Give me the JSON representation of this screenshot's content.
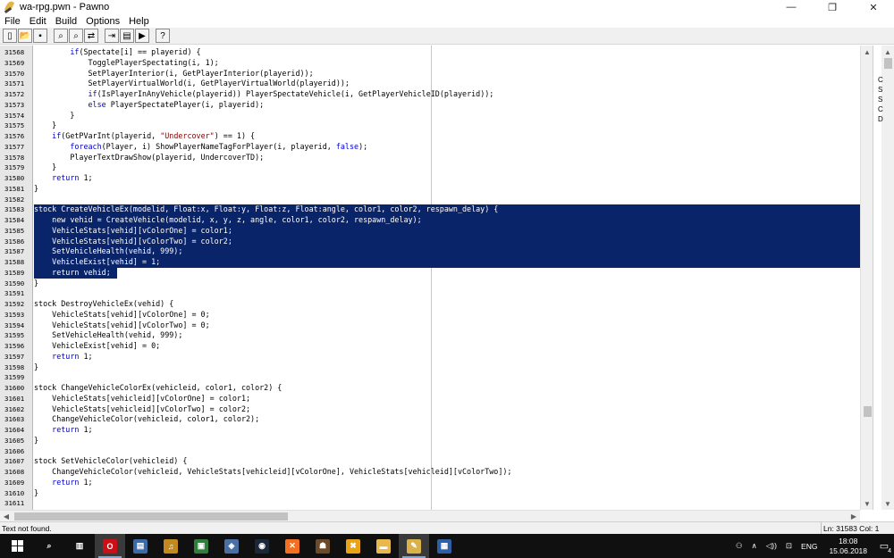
{
  "window": {
    "title": "wa-rpg.pwn - Pawno",
    "minimize": "—",
    "maximize": "❐",
    "close": "✕"
  },
  "menu": [
    "File",
    "Edit",
    "Build",
    "Options",
    "Help"
  ],
  "toolbar": [
    {
      "name": "new-icon",
      "glyph": "▯"
    },
    {
      "name": "open-icon",
      "glyph": "📂"
    },
    {
      "name": "save-icon",
      "glyph": "▪"
    },
    {
      "name": "find-icon",
      "glyph": "⌕"
    },
    {
      "name": "find-next-icon",
      "glyph": "⌕"
    },
    {
      "name": "replace-icon",
      "glyph": "⇄"
    },
    {
      "name": "goto-icon",
      "glyph": "⇥"
    },
    {
      "name": "compile-icon",
      "glyph": "▤"
    },
    {
      "name": "run-icon",
      "glyph": "▶"
    },
    {
      "name": "help-icon",
      "glyph": "?"
    }
  ],
  "editor": {
    "lines": [
      {
        "n": "31568",
        "t": "        if(Spectate[i] == playerid) {"
      },
      {
        "n": "31569",
        "t": "            TogglePlayerSpectating(i, 1);"
      },
      {
        "n": "31570",
        "t": "            SetPlayerInterior(i, GetPlayerInterior(playerid));"
      },
      {
        "n": "31571",
        "t": "            SetPlayerVirtualWorld(i, GetPlayerVirtualWorld(playerid));"
      },
      {
        "n": "31572",
        "t": "            if(IsPlayerInAnyVehicle(playerid)) PlayerSpectateVehicle(i, GetPlayerVehicleID(playerid));"
      },
      {
        "n": "31573",
        "t": "            else PlayerSpectatePlayer(i, playerid);"
      },
      {
        "n": "31574",
        "t": "        }"
      },
      {
        "n": "31575",
        "t": "    }"
      },
      {
        "n": "31576",
        "t": "    if(GetPVarInt(playerid, \"Undercover\") == 1) {"
      },
      {
        "n": "31577",
        "t": "        foreach(Player, i) ShowPlayerNameTagForPlayer(i, playerid, false);"
      },
      {
        "n": "31578",
        "t": "        PlayerTextDrawShow(playerid, UndercoverTD);"
      },
      {
        "n": "31579",
        "t": "    }"
      },
      {
        "n": "31580",
        "t": "    return 1;"
      },
      {
        "n": "31581",
        "t": "}"
      },
      {
        "n": "31582",
        "t": ""
      },
      {
        "n": "31583",
        "t": "stock CreateVehicleEx(modelid, Float:x, Float:y, Float:z, Float:angle, color1, color2, respawn_delay) {",
        "sel": true
      },
      {
        "n": "31584",
        "t": "    new vehid = CreateVehicle(modelid, x, y, z, angle, color1, color2, respawn_delay);",
        "sel": true
      },
      {
        "n": "31585",
        "t": "    VehicleStats[vehid][vColorOne] = color1;",
        "sel": true
      },
      {
        "n": "31586",
        "t": "    VehicleStats[vehid][vColorTwo] = color2;",
        "sel": true
      },
      {
        "n": "31587",
        "t": "    SetVehicleHealth(vehid, 999);",
        "sel": true
      },
      {
        "n": "31588",
        "t": "    VehicleExist[vehid] = 1;",
        "sel": true
      },
      {
        "n": "31589",
        "t": "    return vehid;",
        "sel": "partial"
      },
      {
        "n": "31590",
        "t": "}"
      },
      {
        "n": "31591",
        "t": ""
      },
      {
        "n": "31592",
        "t": "stock DestroyVehicleEx(vehid) {"
      },
      {
        "n": "31593",
        "t": "    VehicleStats[vehid][vColorOne] = 0;"
      },
      {
        "n": "31594",
        "t": "    VehicleStats[vehid][vColorTwo] = 0;"
      },
      {
        "n": "31595",
        "t": "    SetVehicleHealth(vehid, 999);"
      },
      {
        "n": "31596",
        "t": "    VehicleExist[vehid] = 0;"
      },
      {
        "n": "31597",
        "t": "    return 1;"
      },
      {
        "n": "31598",
        "t": "}"
      },
      {
        "n": "31599",
        "t": ""
      },
      {
        "n": "31600",
        "t": "stock ChangeVehicleColorEx(vehicleid, color1, color2) {"
      },
      {
        "n": "31601",
        "t": "    VehicleStats[vehicleid][vColorOne] = color1;"
      },
      {
        "n": "31602",
        "t": "    VehicleStats[vehicleid][vColorTwo] = color2;"
      },
      {
        "n": "31603",
        "t": "    ChangeVehicleColor(vehicleid, color1, color2);"
      },
      {
        "n": "31604",
        "t": "    return 1;"
      },
      {
        "n": "31605",
        "t": "}"
      },
      {
        "n": "31606",
        "t": ""
      },
      {
        "n": "31607",
        "t": "stock SetVehicleColor(vehicleid) {"
      },
      {
        "n": "31608",
        "t": "    ChangeVehicleColor(vehicleid, VehicleStats[vehicleid][vColorOne], VehicleStats[vehicleid][vColorTwo]);"
      },
      {
        "n": "31609",
        "t": "    return 1;"
      },
      {
        "n": "31610",
        "t": "}"
      },
      {
        "n": "31611",
        "t": ""
      }
    ]
  },
  "side_panel": {
    "letters": [
      "C",
      "S",
      "S",
      "C",
      "D"
    ]
  },
  "status": {
    "message": "Text not found.",
    "position": "Ln: 31583   Col: 1"
  },
  "taskbar": {
    "apps": [
      {
        "name": "search-icon",
        "glyph": "⌕",
        "color": "#101010"
      },
      {
        "name": "task-view-icon",
        "glyph": "▥",
        "color": "#101010"
      },
      {
        "name": "opera-icon",
        "glyph": "O",
        "color": "#cc0f16",
        "active": true
      },
      {
        "name": "notes-icon",
        "glyph": "▤",
        "color": "#3b6aa8"
      },
      {
        "name": "aimp-icon",
        "glyph": "♫",
        "color": "#c28a1e"
      },
      {
        "name": "remote-icon",
        "glyph": "▣",
        "color": "#2f7e3b"
      },
      {
        "name": "network-icon",
        "glyph": "◈",
        "color": "#4a6fa5"
      },
      {
        "name": "steam-icon",
        "glyph": "◉",
        "color": "#1b2838"
      },
      {
        "name": "xampp-icon",
        "glyph": "✕",
        "color": "#f37021"
      },
      {
        "name": "game-icon",
        "glyph": "☗",
        "color": "#6b4a2a"
      },
      {
        "name": "tool-icon",
        "glyph": "✖",
        "color": "#e8a317"
      },
      {
        "name": "folder-icon",
        "glyph": "▬",
        "color": "#e7b84a"
      },
      {
        "name": "pawno-icon",
        "glyph": "✎",
        "color": "#d9b24a",
        "active": true
      },
      {
        "name": "photos-icon",
        "glyph": "▦",
        "color": "#2e5fa6"
      }
    ],
    "tray": {
      "people": "⚇",
      "chevron": "∧",
      "volume": "◁))",
      "network": "⊡",
      "lang": "ENG",
      "time": "18:08",
      "date": "15.06.2018",
      "notifications": "4"
    }
  },
  "colors": {
    "selection": "#0a246a",
    "gutter": "#e6e6e6",
    "keyword": "#0000c8",
    "string": "#800000",
    "taskbar": "#101010"
  }
}
